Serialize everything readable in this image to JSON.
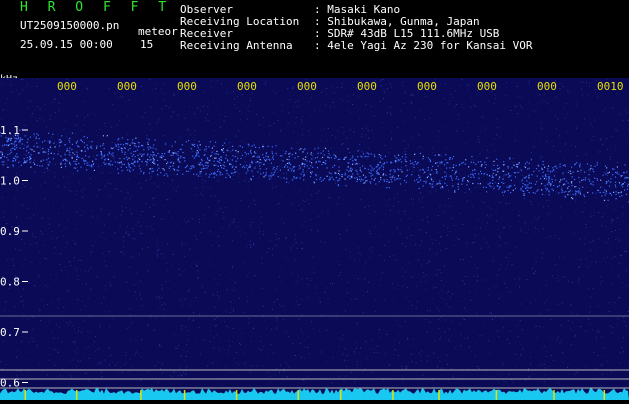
{
  "header": {
    "title": "H R O F F T",
    "file_name": "UT2509150000.pn",
    "file_suffix": "meteor",
    "datetime": "25.09.15 00:00",
    "count": "15"
  },
  "meta": {
    "labels": [
      "Observer",
      "Receiving Location",
      "Receiver",
      "Receiving Antenna"
    ],
    "values": [
      ": Masaki Kano",
      ": Shibukawa, Gunma, Japan",
      ": SDR# 43dB L15 111.6MHz USB",
      ": 4ele Yagi Az 230 for Kansai VOR"
    ]
  },
  "axis": {
    "unit": "kHz",
    "y_ticks": [
      "1.1",
      "1.0",
      "0.9",
      "0.8",
      "0.7",
      "0.6"
    ],
    "x_ticks": [
      "000",
      "000",
      "000",
      "000",
      "000",
      "000",
      "000",
      "000",
      "000",
      "0010"
    ]
  },
  "colors": {
    "background": "#000000",
    "spectrum_bg": "#0a0a56",
    "signal": "#3a6cff",
    "tick": "#e8e000",
    "baseline": "#19c8f0",
    "title": "#2ee62e"
  }
}
